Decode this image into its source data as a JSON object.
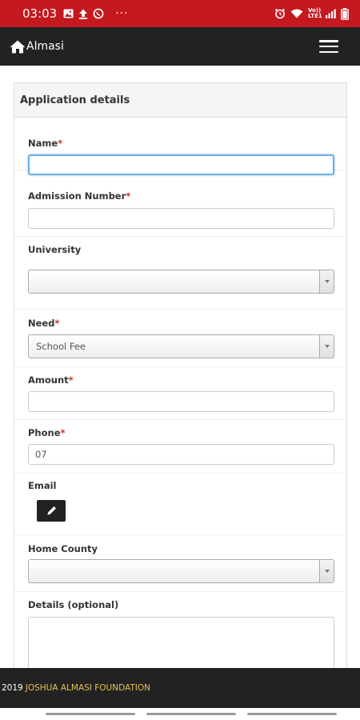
{
  "status_bar": {
    "time": "03:03",
    "left_icons": [
      "image-icon",
      "upload-icon",
      "whatsapp-icon",
      "more-icon"
    ],
    "right_icons": [
      "alarm-icon",
      "wifi-icon",
      "volte-icon",
      "signal-icon",
      "battery-icon"
    ],
    "volte_text": "Vo)) LTE1",
    "more_text": "···"
  },
  "navbar": {
    "brand": "Almasi",
    "menu_icon": "hamburger-icon"
  },
  "panel": {
    "title": "Application details"
  },
  "form": {
    "name": {
      "label": "Name",
      "required": "*",
      "value": ""
    },
    "admission_number": {
      "label": "Admission Number",
      "required": "*",
      "value": ""
    },
    "university": {
      "label": "University",
      "selected": ""
    },
    "need": {
      "label": "Need",
      "required": "*",
      "selected": "School Fee"
    },
    "amount": {
      "label": "Amount",
      "required": "*",
      "value": ""
    },
    "phone": {
      "label": "Phone",
      "required": "*",
      "value": "07"
    },
    "email": {
      "label": "Email",
      "edit_icon": "pencil-icon"
    },
    "home_county": {
      "label": "Home County",
      "selected": ""
    },
    "details": {
      "label": "Details (optional)",
      "value": ""
    }
  },
  "footer": {
    "year": "2019",
    "org": "JOSHUA ALMASI FOUNDATION"
  },
  "colors": {
    "status_bar": "#c4191e",
    "navbar": "#222222",
    "footer_accent": "#e8c252",
    "required": "#c9302c",
    "focus": "#66afe9"
  }
}
